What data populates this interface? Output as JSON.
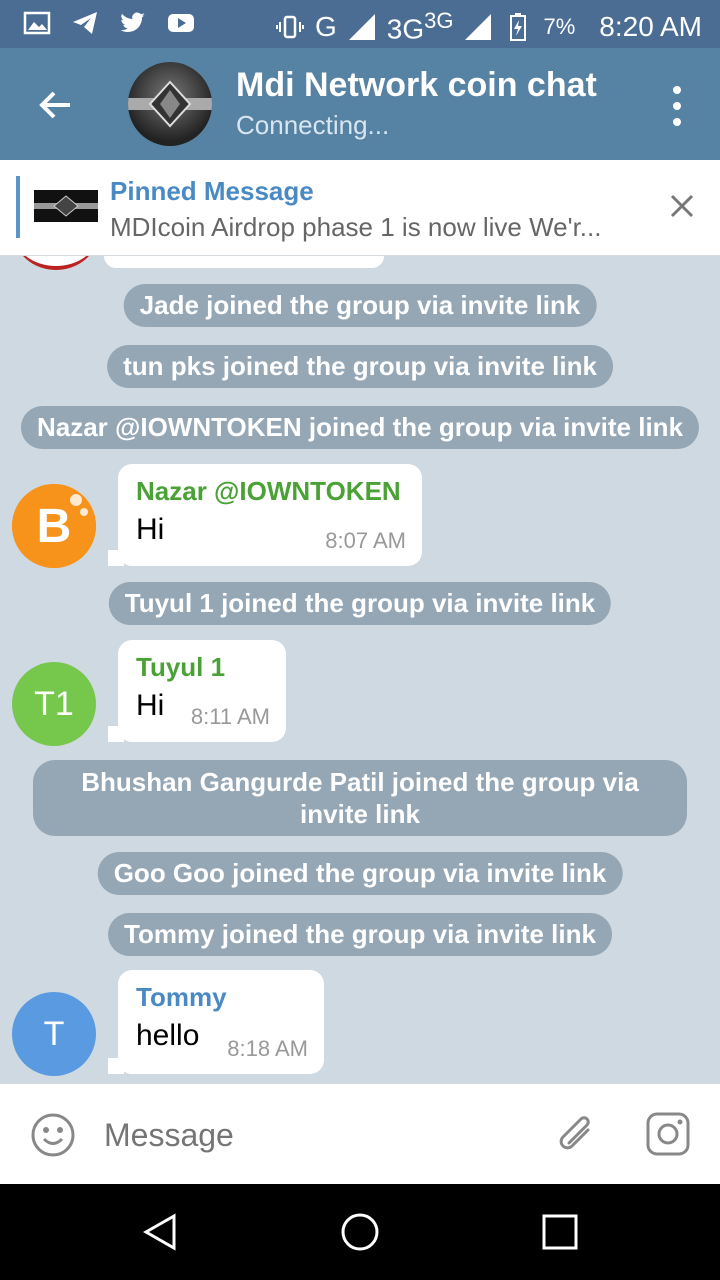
{
  "status_bar": {
    "network": "G",
    "network2": "3G",
    "network2_sup": "3G",
    "battery": "7%",
    "time": "8:20 AM"
  },
  "header": {
    "title": "Mdi Network coin chat",
    "subtitle": "Connecting..."
  },
  "pinned": {
    "title": "Pinned Message",
    "text": "MDIcoin Airdrop phase 1 is now live We'r..."
  },
  "messages": {
    "service_1": "Jade joined the group via invite link",
    "service_2": "tun pks joined the group via invite link",
    "service_3": "Nazar @IOWNTOKEN joined the group via invite link",
    "msg_1": {
      "name": "Nazar @IOWNTOKEN",
      "text": "Hi",
      "time": "8:07 AM",
      "name_color": "#4aa236",
      "avatar_letter": "B"
    },
    "service_4": "Tuyul 1 joined the group via invite link",
    "msg_2": {
      "name": "Tuyul 1",
      "text": "Hi",
      "time": "8:11 AM",
      "name_color": "#4aa236",
      "avatar_initials": "T1",
      "avatar_color": "#76c84d"
    },
    "service_5": "Bhushan Gangurde Patil joined the group via invite link",
    "service_6": "Goo Goo joined the group via invite link",
    "service_7": "Tommy joined the group via invite link",
    "msg_3": {
      "name": "Tommy",
      "text": "hello",
      "time": "8:18 AM",
      "name_color": "#4a8ac4",
      "avatar_initials": "T",
      "avatar_color": "#5a9ae0"
    }
  },
  "input": {
    "placeholder": "Message"
  },
  "colors": {
    "header_bg": "#5682a3",
    "status_bg": "#4b6d94",
    "chat_bg": "#cfd9e2",
    "accent": "#4a8ac4"
  }
}
